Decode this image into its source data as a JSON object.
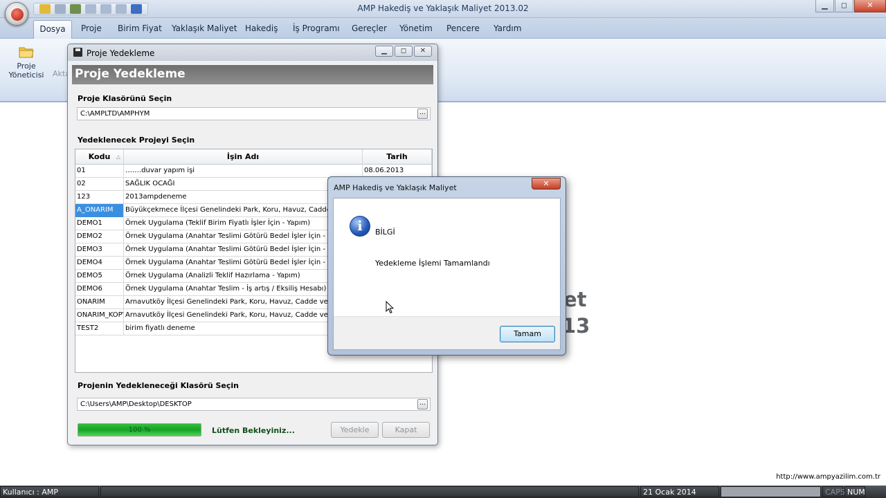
{
  "window": {
    "title": "AMP Hakediş ve Yaklaşık Maliyet 2013.02",
    "controls": {
      "minimize": "▁",
      "maximize": "◻",
      "close": "✕"
    }
  },
  "menu": [
    "Dosya",
    "Proje",
    "Birim Fiyat",
    "Yaklaşık Maliyet",
    "Hakediş",
    "İş Programı",
    "Gereçler",
    "Yönetim",
    "Pencere",
    "Yardım"
  ],
  "ribbon": {
    "proje_yoneticisi": "Proje Yöneticisi",
    "aktar": "Akta"
  },
  "background_text": {
    "line1": "et",
    "line2": "13"
  },
  "footer_url": "http://www.ampyazilim.com.tr",
  "status": {
    "user": "Kullanıcı : AMP",
    "date": "21 Ocak 2014",
    "caps": "CAPS",
    "num": "NUM"
  },
  "dialog": {
    "title": "Proje Yedekleme",
    "header": "Proje Yedekleme",
    "controls": {
      "minimize": "▁",
      "maximize": "◻",
      "close": "✕"
    },
    "source_label": "Proje Klasörünü Seçin",
    "source_path": "C:\\AMPLTD\\AMPHYM",
    "projects_label": "Yedeklenecek Projeyi Seçin",
    "columns": [
      "Kodu",
      "İşin Adı",
      "Tarih"
    ],
    "sort_indicator": "△",
    "rows": [
      [
        "01",
        "…….duvar yapım işi",
        "08.06.2013"
      ],
      [
        "02",
        "SAĞLIK OCAĞI",
        ""
      ],
      [
        "123",
        "2013ampdeneme",
        ""
      ],
      [
        "A_ONARIM",
        "Büyükçekmece İlçesi Genelindeki Park, Koru, Havuz, Cadde ve Yol",
        ""
      ],
      [
        "DEMO1",
        "Örnek Uygulama (Teklif Birim Fiyatlı İşler İçin - Yapım)",
        ""
      ],
      [
        "DEMO2",
        "Örnek Uygulama (Anahtar Teslimi Götürü Bedel İşler İçin - Yapım)",
        ""
      ],
      [
        "DEMO3",
        "Örnek Uygulama (Anahtar Teslimi Götürü Bedel İşler İçin - Yapım)",
        ""
      ],
      [
        "DEMO4",
        "Örnek Uygulama (Anahtar Teslimi Götürü Bedel İşler İçin - Yapım)",
        ""
      ],
      [
        "DEMO5",
        "Örnek Uygulama (Analizli Teklif Hazırlama - Yapım)",
        ""
      ],
      [
        "DEMO6",
        "Örnek Uygulama (Anahtar Teslim - İş artış / Eksiliş Hesabı) YALNIZ",
        ""
      ],
      [
        "ONARIM",
        "Arnavutköy İlçesi Genelindeki Park, Koru, Havuz, Cadde ve Yol",
        ""
      ],
      [
        "ONARIM_KOPYA",
        "Arnavutköy İlçesi Genelindeki Park, Koru, Havuz, Cadde ve Yol",
        ""
      ],
      [
        "TEST2",
        "birim fiyatlı deneme",
        ""
      ]
    ],
    "selected_row": 3,
    "target_label": "Projenin Yedekleneceği Klasörü Seçin",
    "target_path": "C:\\Users\\AMP\\Desktop\\DESKTOP",
    "browse": "...",
    "progress_percent": 100,
    "progress_text": "100 %",
    "wait_text": "Lütfen Bekleyiniz...",
    "backup_button": "Yedekle",
    "close_button": "Kapat"
  },
  "messagebox": {
    "title": "AMP Hakediş ve Yaklaşık Maliyet",
    "close": "✕",
    "icon": "i",
    "heading": "BİLGİ",
    "message": "Yedekleme İşlemi Tamamlandı",
    "ok_button": "Tamam"
  }
}
